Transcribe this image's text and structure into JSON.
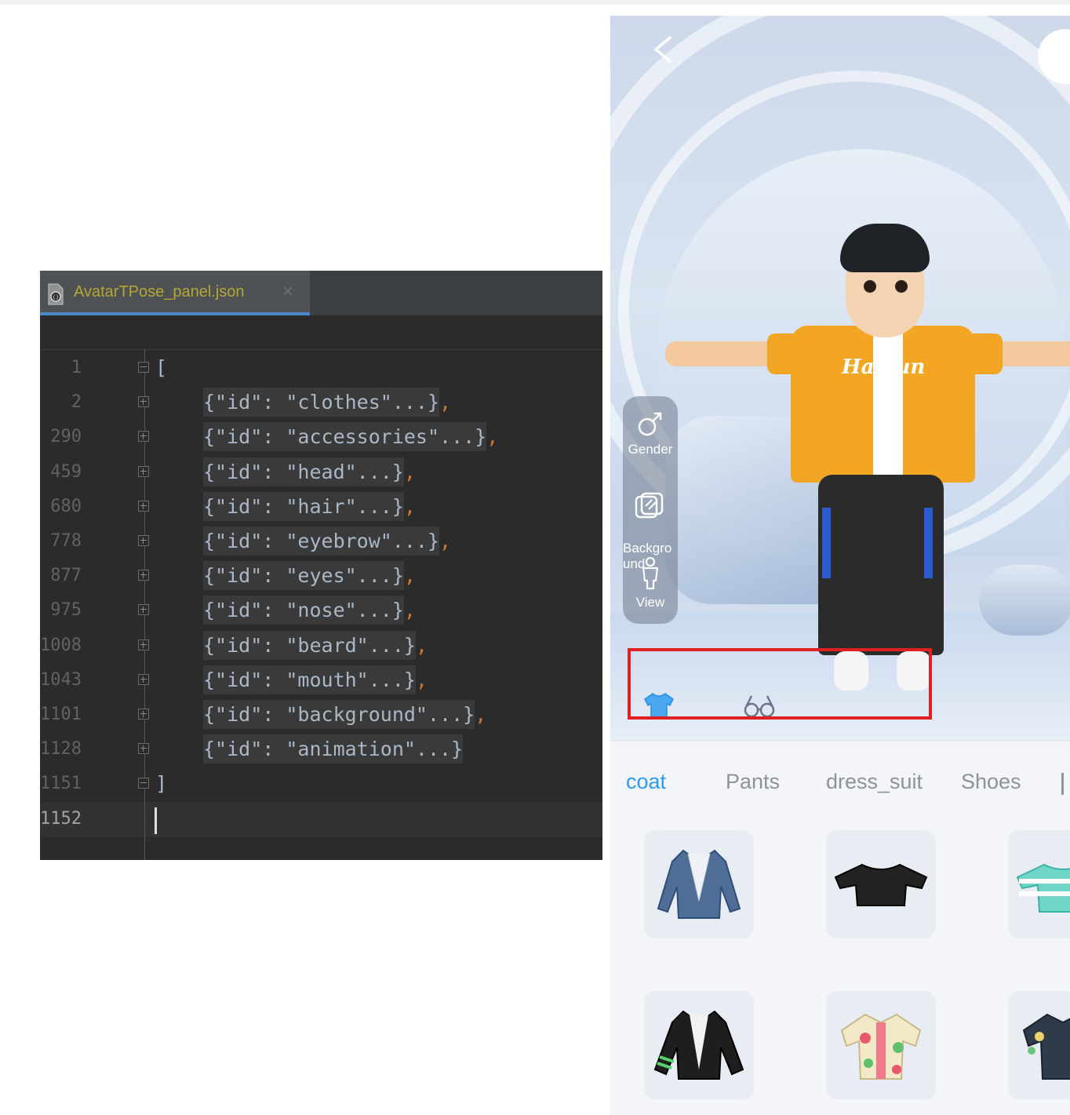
{
  "editor": {
    "tab_label": "AvatarTPose_panel.json",
    "close_glyph": "×",
    "lines": [
      {
        "num": "1",
        "fold": "minus",
        "bracket": "[",
        "text": ""
      },
      {
        "num": "2",
        "fold": "plus",
        "text": "{\"id\": \"clothes\"...}",
        "comma": ","
      },
      {
        "num": "290",
        "fold": "plus",
        "text": "{\"id\": \"accessories\"...}",
        "comma": ","
      },
      {
        "num": "459",
        "fold": "plus",
        "text": "{\"id\": \"head\"...}",
        "comma": ","
      },
      {
        "num": "680",
        "fold": "plus",
        "text": "{\"id\": \"hair\"...}",
        "comma": ","
      },
      {
        "num": "778",
        "fold": "plus",
        "text": "{\"id\": \"eyebrow\"...}",
        "comma": ","
      },
      {
        "num": "877",
        "fold": "plus",
        "text": "{\"id\": \"eyes\"...}",
        "comma": ","
      },
      {
        "num": "975",
        "fold": "plus",
        "text": "{\"id\": \"nose\"...}",
        "comma": ","
      },
      {
        "num": "1008",
        "fold": "plus",
        "text": "{\"id\": \"beard\"...}",
        "comma": ","
      },
      {
        "num": "1043",
        "fold": "plus",
        "text": "{\"id\": \"mouth\"...}",
        "comma": ","
      },
      {
        "num": "1101",
        "fold": "plus",
        "text": "{\"id\": \"background\"...}",
        "comma": ","
      },
      {
        "num": "1128",
        "fold": "plus",
        "text": "{\"id\": \"animation\"...}",
        "comma": ""
      },
      {
        "num": "1151",
        "fold": "minus",
        "bracket": "]",
        "text": ""
      },
      {
        "num": "1152",
        "fold": "",
        "text": "",
        "current": true
      }
    ],
    "colors": {
      "background": "#2b2b2b",
      "tab_text": "#b7a633",
      "code": "#a9b7c6",
      "comma": "#cc7832",
      "line_number": "#606366"
    }
  },
  "app": {
    "back_icon": "chevron-left-icon",
    "avatar_shirt_text": "Ha Fun",
    "side_tools": [
      {
        "label": "Gender",
        "icon": "gender-male-icon"
      },
      {
        "label": "Backgro\nund",
        "icon": "background-icon"
      },
      {
        "label": "View",
        "icon": "person-view-icon"
      }
    ],
    "category_icons": [
      "tshirt-icon",
      "glasses-icon"
    ],
    "tabs": [
      {
        "label": "coat",
        "active": true
      },
      {
        "label": "Pants",
        "active": false
      },
      {
        "label": "dress_suit",
        "active": false
      },
      {
        "label": "Shoes",
        "active": false
      }
    ],
    "items": [
      "denim-blazer",
      "black-crop-top",
      "teal-striped-tee",
      "black-jacket-green-stripes",
      "floral-shirt",
      "dark-floral-shirt"
    ],
    "colors": {
      "accent": "#2b9cf2",
      "tab_inactive": "#8e929a",
      "highlight_box": "#e02020",
      "shirt": "#f2a623"
    }
  }
}
